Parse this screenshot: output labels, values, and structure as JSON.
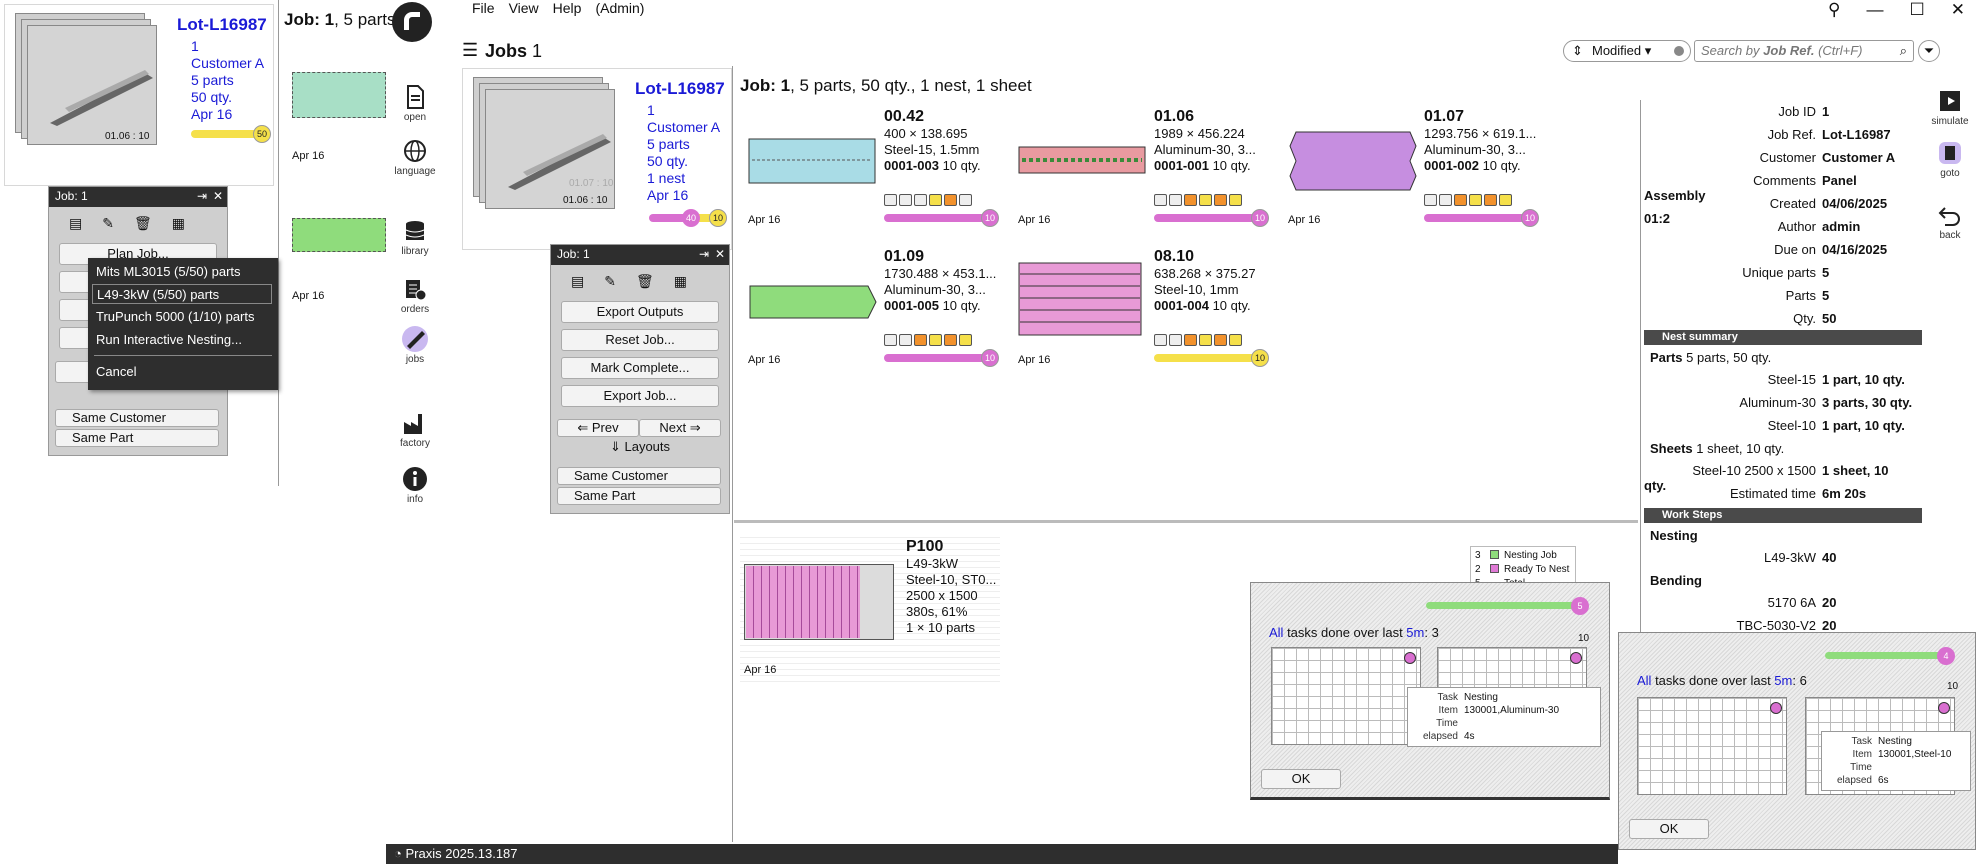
{
  "menu": {
    "file": "File",
    "view": "View",
    "help": "Help",
    "admin": "(Admin)"
  },
  "jobs_header": {
    "title": "Jobs",
    "count": "1"
  },
  "sort": {
    "label": "Modified"
  },
  "search": {
    "placeholder": "Search by Job Ref. (Ctrl+F)",
    "placeholder_prefix": "Search by ",
    "placeholder_emph": "Job Ref.",
    "placeholder_suffix": " (Ctrl+F)"
  },
  "job_card": {
    "lot": "Lot-L16987",
    "num": "1",
    "customer": "Customer A",
    "parts": "5 parts",
    "qty": "50 qty.",
    "nests": "1 nest",
    "date": "Apr 16",
    "stack_code": "01.06 : 10",
    "stack_faint": "01.07 : 10",
    "badge_a": "40",
    "badge_b": "10",
    "badge_single": "50"
  },
  "left_panel": {
    "job_title": "Job: 1",
    "job_summary": "5 parts",
    "date1": "Apr 16",
    "date2": "Apr 16",
    "plan_job": "Plan Job...",
    "same_customer": "Same Customer",
    "same_part": "Same Part",
    "dots": "Tools"
  },
  "context_menu": {
    "items": [
      "Mits ML3015  (5/50) parts",
      "L49-3kW  (5/50) parts",
      "TruPunch 5000  (1/10) parts",
      "Run Interactive Nesting...",
      "Cancel"
    ]
  },
  "sidebar": {
    "open": "open",
    "language": "language",
    "library": "library",
    "orders": "orders",
    "jobs": "jobs",
    "factory": "factory",
    "info": "info"
  },
  "job_panel": {
    "title": "Job: 1",
    "export_outputs": "Export Outputs",
    "reset_job": "Reset Job...",
    "mark_complete": "Mark Complete...",
    "export_job": "Export Job...",
    "prev": "Prev",
    "next": "Next",
    "layouts": "Layouts",
    "same_customer": "Same Customer",
    "same_part": "Same Part"
  },
  "job_summary": {
    "job": "Job: ",
    "num": "1",
    "rest": ", 5 parts, 50 qty., 1 nest, 1 sheet"
  },
  "parts": [
    {
      "name": "00.42",
      "dims": "400 × 138.695",
      "mat": "Steel-15, 1.5mm",
      "id": "0001-003",
      "qty": "10 qty.",
      "date": "Apr 16",
      "badge": "10",
      "color": "#a9dce6"
    },
    {
      "name": "01.06",
      "dims": "1989 × 456.224",
      "mat": "Aluminum-30, 3...",
      "id": "0001-001",
      "qty": "10 qty.",
      "date": "Apr 16",
      "badge": "10",
      "color": "#e89aa0"
    },
    {
      "name": "01.07",
      "dims": "1293.756 × 619.1...",
      "mat": "Aluminum-30, 3...",
      "id": "0001-002",
      "qty": "10 qty.",
      "date": "Apr 16",
      "badge": "10",
      "color": "#c68ee0"
    },
    {
      "name": "01.09",
      "dims": "1730.488 × 453.1...",
      "mat": "Aluminum-30, 3...",
      "id": "0001-005",
      "qty": "10 qty.",
      "date": "Apr 16",
      "badge": "10",
      "color": "#8fdc7c"
    },
    {
      "name": "08.10",
      "dims": "638.268 × 375.27",
      "mat": "Steel-10, 1mm",
      "id": "0001-004",
      "qty": "10 qty.",
      "date": "Apr 16",
      "badge": "10",
      "color": "#e89ad6"
    }
  ],
  "nest": {
    "name": "P100",
    "machine": "L49-3kW",
    "mat": "Steel-10, ST0...",
    "size": "2500 x 1500",
    "time": "380s, 61%",
    "parts": "1 × 10 parts",
    "date": "Apr 16"
  },
  "details": {
    "rows": [
      {
        "k": "Job ID",
        "v": "1"
      },
      {
        "k": "Job Ref.",
        "v": "Lot-L16987"
      },
      {
        "k": "Customer",
        "v": "Customer A"
      },
      {
        "k": "Comments",
        "v": "Panel Assembly"
      },
      {
        "k": "Created",
        "v": "04/06/2025 01:2"
      },
      {
        "k": "Author",
        "v": "admin"
      },
      {
        "k": "Due on",
        "v": "04/16/2025"
      },
      {
        "k": "Unique parts",
        "v": "5"
      },
      {
        "k": "Parts",
        "v": "5"
      },
      {
        "k": "Qty.",
        "v": "50"
      }
    ],
    "nest_summary": "Nest summary",
    "parts_label": "Parts",
    "parts_value": "5 parts, 50 qty.",
    "mats": [
      {
        "k": "Steel-15",
        "v": "1 part, 10 qty."
      },
      {
        "k": "Aluminum-30",
        "v": "3 parts, 30 qty."
      },
      {
        "k": "Steel-10",
        "v": "1 part, 10 qty."
      }
    ],
    "sheets_label": "Sheets",
    "sheets_value": "1 sheet, 10 qty.",
    "sheet_row": {
      "k": "Steel-10 2500 x 1500",
      "v": "1 sheet, 10 qty."
    },
    "est": {
      "k": "Estimated time",
      "v": "6m 20s"
    },
    "work_steps": "Work Steps",
    "nesting": "Nesting",
    "nest_machine": {
      "k": "L49-3kW",
      "v": "40"
    },
    "bending": "Bending",
    "bend1": {
      "k": "5170 6A",
      "v": "20"
    },
    "bend2": {
      "k": "TBC-5030-V2",
      "v": "20"
    }
  },
  "right_bar": {
    "simulate": "simulate",
    "goto": "goto",
    "back": "back"
  },
  "legend": {
    "rows": [
      {
        "n": "3",
        "label": "Nesting Job",
        "color": "#8fdc7c"
      },
      {
        "n": "2",
        "label": "Ready To Nest",
        "color": "#e07ad6"
      },
      {
        "n": "5",
        "label": "Total"
      }
    ],
    "badge": "5"
  },
  "dialog1": {
    "all": "All",
    "text": " tasks done over last ",
    "span": "5m",
    "count": ": 3",
    "axis_max": "10",
    "task_k": "Task",
    "task_v": "Nesting",
    "item_k": "Item",
    "item_v": "130001,Aluminum-30",
    "time_k": "Time elapsed",
    "time_v": "4s",
    "ok": "OK"
  },
  "dialog2": {
    "all": "All",
    "text": " tasks done over last ",
    "span": "5m",
    "count": ": 6",
    "axis_max": "10",
    "task_k": "Task",
    "task_v": "Nesting",
    "item_k": "Item",
    "item_v": "130001,Steel-10",
    "time_k": "Time elapsed",
    "time_v": "6s",
    "ok": "OK",
    "badge": "4"
  },
  "status": {
    "version": "Praxis 2025.13.187"
  }
}
